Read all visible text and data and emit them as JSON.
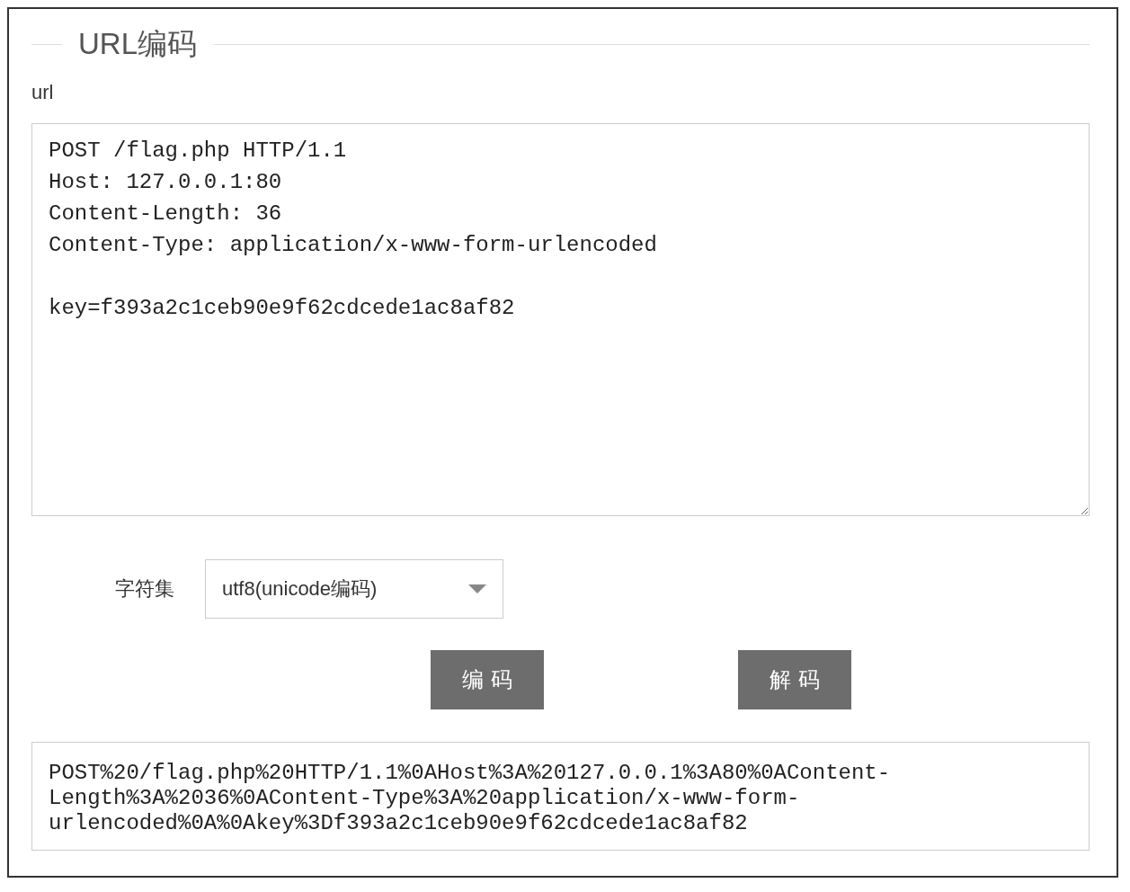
{
  "legend": "URL编码",
  "input": {
    "label": "url",
    "value": "POST /flag.php HTTP/1.1\nHost: 127.0.0.1:80\nContent-Length: 36\nContent-Type: application/x-www-form-urlencoded\n\nkey=f393a2c1ceb90e9f62cdcede1ac8af82"
  },
  "charset": {
    "label": "字符集",
    "value": "utf8(unicode编码)"
  },
  "buttons": [
    {
      "label": "编 码"
    },
    {
      "label": "解 码"
    }
  ],
  "output": "POST%20/flag.php%20HTTP/1.1%0AHost%3A%20127.0.0.1%3A80%0AContent-Length%3A%2036%0AContent-Type%3A%20application/x-www-form-urlencoded%0A%0Akey%3Df393a2c1ceb90e9f62cdcede1ac8af82"
}
